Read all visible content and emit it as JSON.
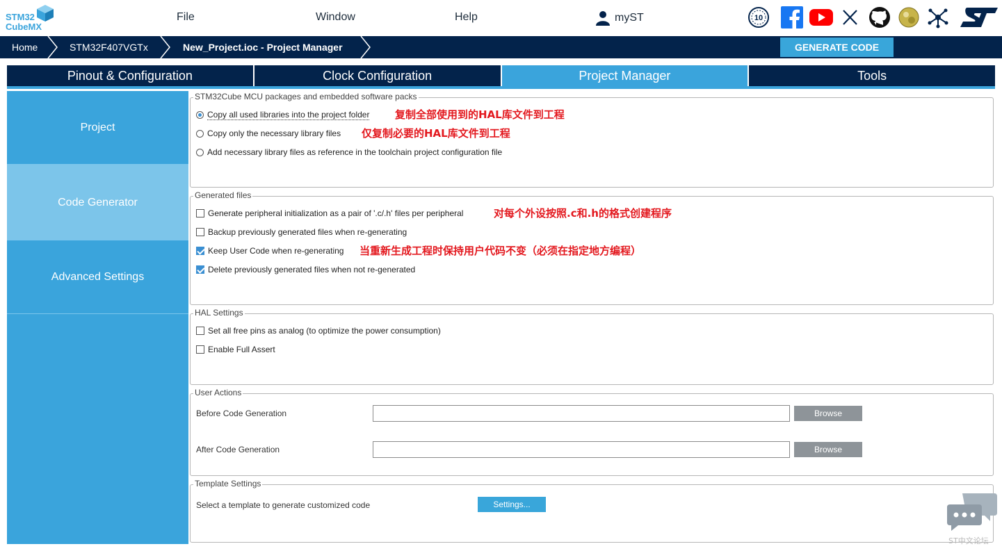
{
  "logo": {
    "line1": "STM32",
    "line2": "CubeMX"
  },
  "menu": {
    "file": "File",
    "window": "Window",
    "help": "Help",
    "myst": "myST"
  },
  "social_icons": [
    "anniversary-10-icon",
    "facebook-icon",
    "youtube-icon",
    "x-icon",
    "github-icon",
    "wiki-icon",
    "network-icon",
    "st-logo-icon"
  ],
  "breadcrumb": {
    "home": "Home",
    "mcu": "STM32F407VGTx",
    "project": "New_Project.ioc - Project Manager"
  },
  "generate_button": "GENERATE CODE",
  "tabs": [
    {
      "label": "Pinout & Configuration",
      "active": false
    },
    {
      "label": "Clock Configuration",
      "active": false
    },
    {
      "label": "Project Manager",
      "active": true
    },
    {
      "label": "Tools",
      "active": false
    }
  ],
  "sidebar": {
    "items": [
      {
        "label": "Project",
        "active": false
      },
      {
        "label": "Code Generator",
        "active": true
      },
      {
        "label": "Advanced Settings",
        "active": false
      }
    ]
  },
  "packages": {
    "legend": "STM32Cube MCU packages and embedded software packs",
    "options": [
      {
        "label": "Copy all used libraries into the project folder",
        "selected": true,
        "note": "复制全部使用到的HAL库文件到工程"
      },
      {
        "label": "Copy only the necessary library files",
        "selected": false,
        "note": "仅复制必要的HAL库文件到工程"
      },
      {
        "label": "Add necessary library files as reference in the toolchain project configuration file",
        "selected": false,
        "note": ""
      }
    ]
  },
  "generated_files": {
    "legend": "Generated files",
    "options": [
      {
        "label": "Generate peripheral initialization as a pair of '.c/.h' files per peripheral",
        "checked": false,
        "note": "对每个外设按照.c和.h的格式创建程序"
      },
      {
        "label": "Backup previously generated files when re-generating",
        "checked": false,
        "note": ""
      },
      {
        "label": "Keep User Code when re-generating",
        "checked": true,
        "note": "当重新生成工程时保持用户代码不变（必须在指定地方编程）"
      },
      {
        "label": "Delete previously generated files when not re-generated",
        "checked": true,
        "note": ""
      }
    ]
  },
  "hal_settings": {
    "legend": "HAL Settings",
    "options": [
      {
        "label": "Set all free pins as analog (to optimize the power consumption)",
        "checked": false
      },
      {
        "label": "Enable Full Assert",
        "checked": false
      }
    ]
  },
  "user_actions": {
    "legend": "User Actions",
    "before_label": "Before Code Generation",
    "before_value": "",
    "after_label": "After Code Generation",
    "after_value": "",
    "browse_label": "Browse"
  },
  "template_settings": {
    "legend": "Template Settings",
    "label": "Select a template to generate customized code",
    "button": "Settings..."
  },
  "watermark": "ST中文论坛",
  "colors": {
    "navy": "#03234b",
    "accent": "#3aa4dc",
    "note_red": "#e3181e"
  }
}
